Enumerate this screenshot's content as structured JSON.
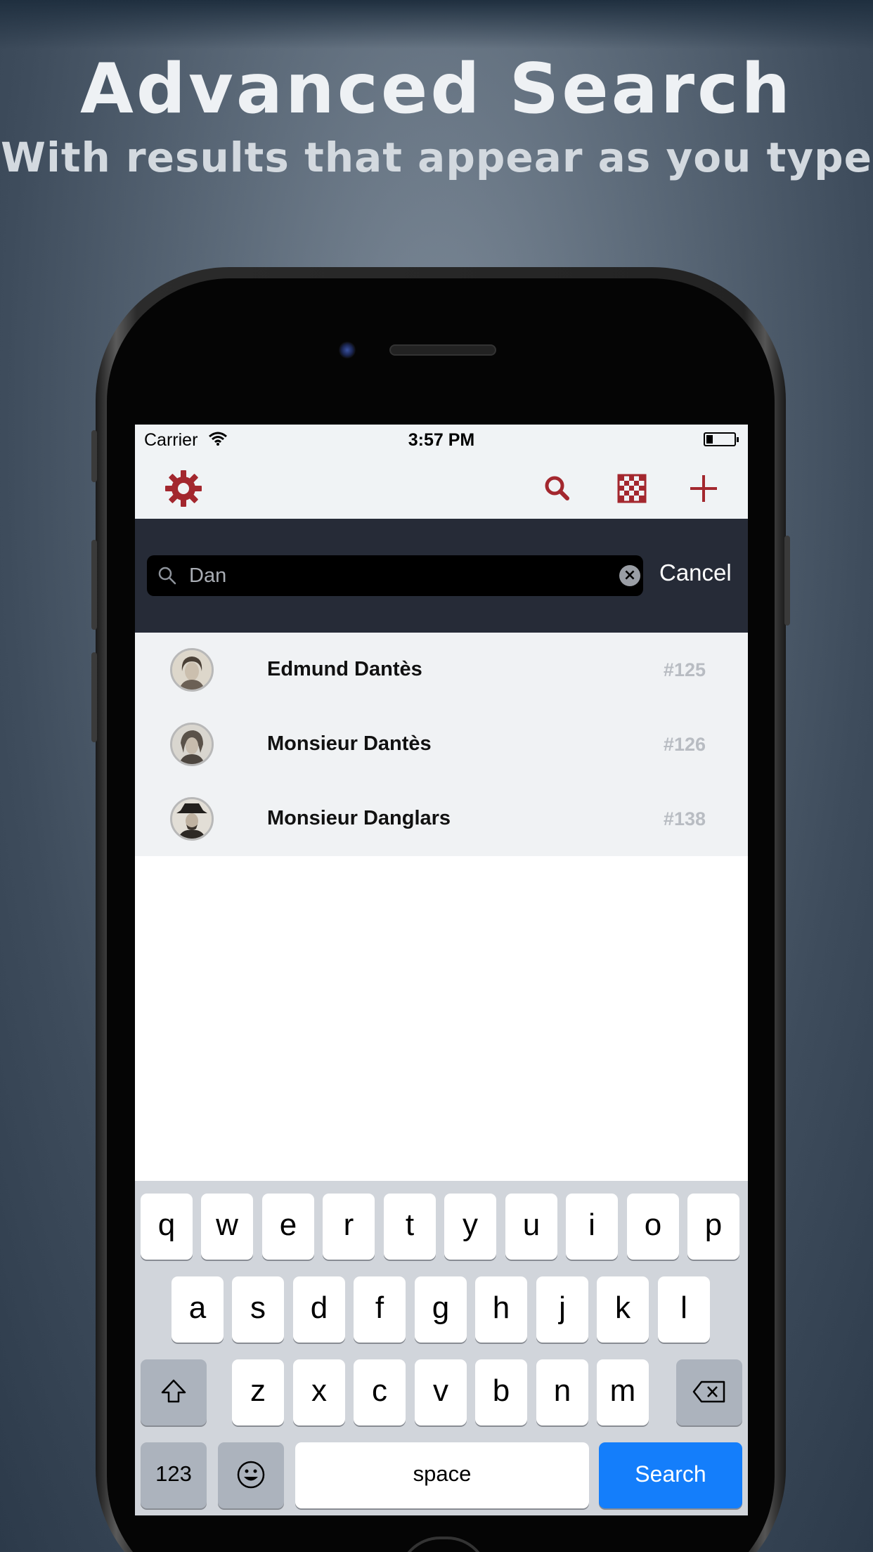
{
  "promo": {
    "title": "Advanced Search",
    "subtitle": "With results that appear as you type"
  },
  "status_bar": {
    "carrier": "Carrier",
    "time": "3:57 PM"
  },
  "navbar": {
    "icons": [
      "gear-icon",
      "search-icon",
      "checkerboard-icon",
      "plus-icon"
    ],
    "accent_color": "#a3272e"
  },
  "search": {
    "value": "Dan",
    "cancel_label": "Cancel"
  },
  "results": [
    {
      "name": "Edmund Dantès",
      "number": "#125"
    },
    {
      "name": "Monsieur Dantès",
      "number": "#126"
    },
    {
      "name": "Monsieur Danglars",
      "number": "#138"
    }
  ],
  "keyboard": {
    "row1": [
      "q",
      "w",
      "e",
      "r",
      "t",
      "y",
      "u",
      "i",
      "o",
      "p"
    ],
    "row2": [
      "a",
      "s",
      "d",
      "f",
      "g",
      "h",
      "j",
      "k",
      "l"
    ],
    "row3": [
      "z",
      "x",
      "c",
      "v",
      "b",
      "n",
      "m"
    ],
    "numbers_label": "123",
    "space_label": "space",
    "action_label": "Search",
    "action_color": "#147efb"
  }
}
